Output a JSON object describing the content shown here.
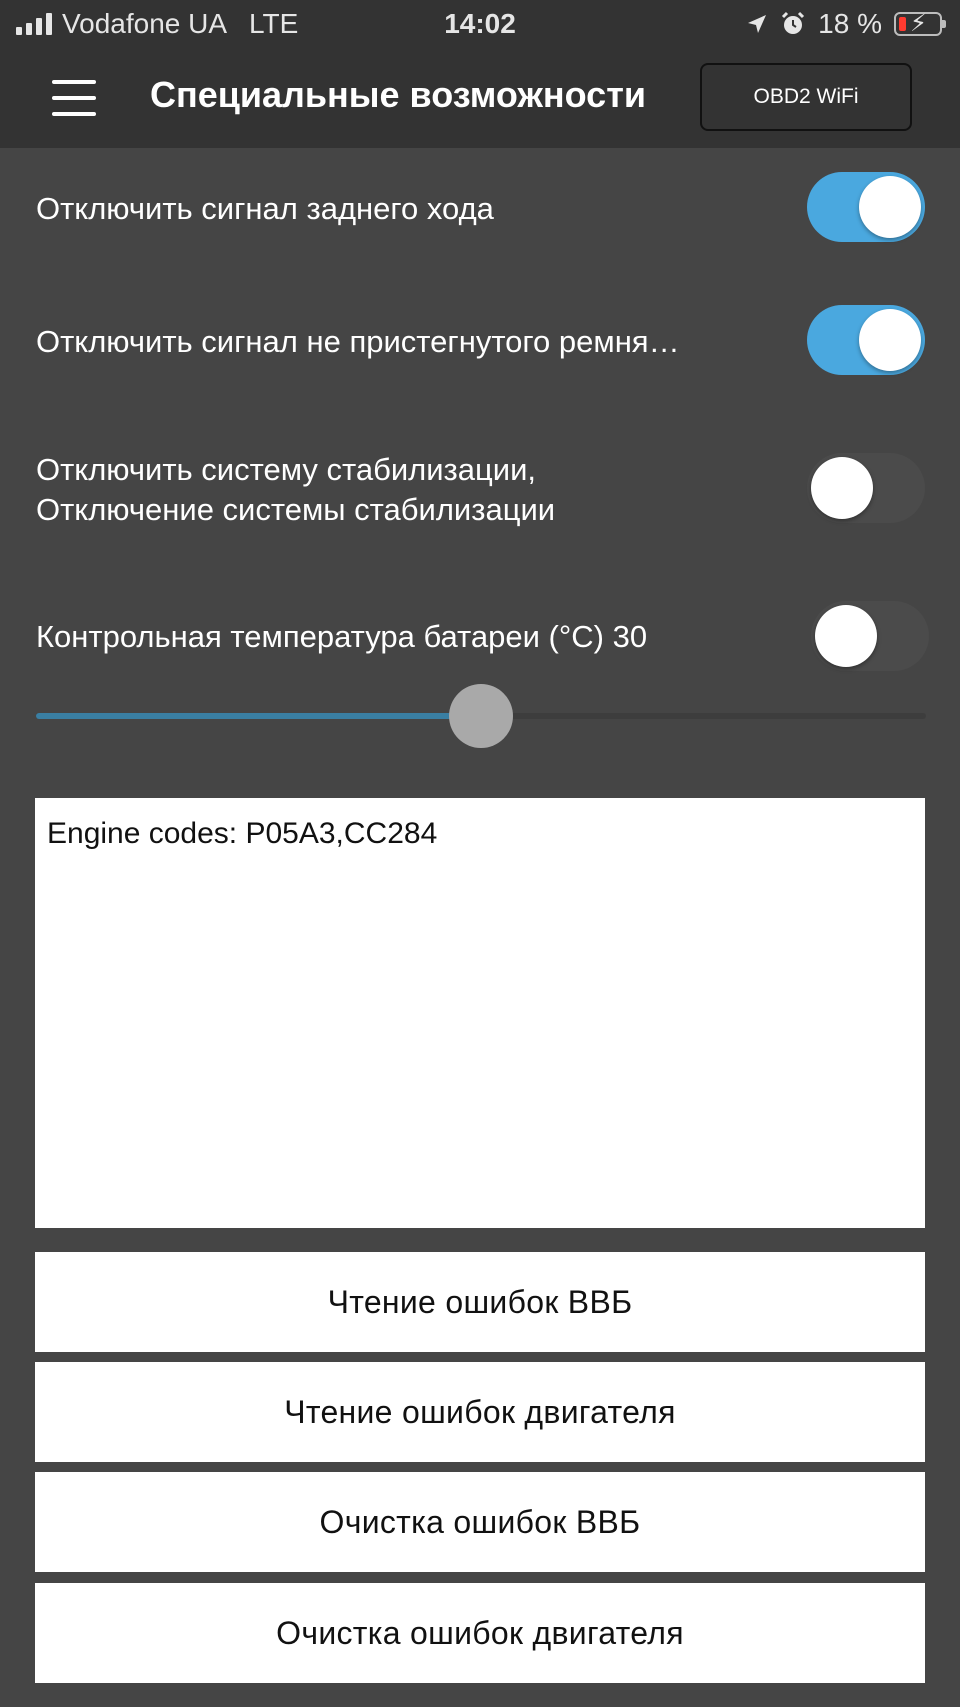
{
  "status_bar": {
    "carrier": "Vodafone UA",
    "network": "LTE",
    "time": "14:02",
    "battery_text": "18 %",
    "icons": [
      "signal-icon",
      "location-arrow-icon",
      "alarm-icon",
      "battery-charging-icon"
    ]
  },
  "header": {
    "title": "Специальные возможности",
    "connection_button": "OBD2 WiFi",
    "menu_icon": "hamburger-icon"
  },
  "settings": [
    {
      "label": "Отключить сигнал заднего хода",
      "enabled": true
    },
    {
      "label": "Отключить сигнал не пристегнутого ремня…",
      "enabled": true
    },
    {
      "label_line1": "Отключить систему стабилизации,",
      "label_line2": "Отключение системы стабилизации",
      "enabled": false
    },
    {
      "label": "Контрольная температура батареи (°C) 30",
      "enabled": false
    }
  ],
  "slider": {
    "fraction": 0.5
  },
  "output": {
    "text": "Engine codes: P05A3,CC284"
  },
  "actions": [
    {
      "label": "Чтение ошибок ВВБ"
    },
    {
      "label": "Чтение ошибок двигателя"
    },
    {
      "label": "Очистка ошибок ВВБ"
    },
    {
      "label": "Очистка ошибок двигателя"
    }
  ],
  "colors": {
    "background": "#454545",
    "bar": "#333333",
    "toggle_on": "#4aa8df",
    "toggle_off": "#4b4b4b",
    "slider_fill": "#3a7fa3",
    "battery_low": "#ff3b30"
  }
}
